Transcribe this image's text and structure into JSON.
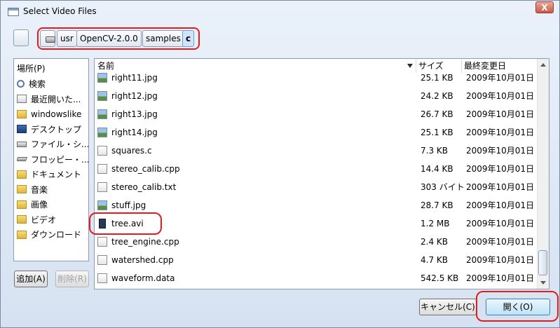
{
  "window": {
    "title": "Select Video Files",
    "close_glyph": "X"
  },
  "path": {
    "segments": [
      "usr",
      "OpenCV-2.0.0",
      "samples",
      "c"
    ]
  },
  "places": {
    "header": "場所(P)",
    "items": [
      {
        "label": "検索",
        "icon": "search-icon"
      },
      {
        "label": "最近開いた...",
        "icon": "recent-icon"
      },
      {
        "label": "windowslike",
        "icon": "folder-icon"
      },
      {
        "label": "デスクトップ",
        "icon": "desktop-icon"
      },
      {
        "label": "ファイル・シ...",
        "icon": "drive-icon"
      },
      {
        "label": "フロッピー・...",
        "icon": "floppy-icon"
      },
      {
        "label": "ドキュメント",
        "icon": "folder-icon"
      },
      {
        "label": "音楽",
        "icon": "folder-icon"
      },
      {
        "label": "画像",
        "icon": "folder-icon"
      },
      {
        "label": "ビデオ",
        "icon": "folder-icon"
      },
      {
        "label": "ダウンロード",
        "icon": "download-folder-icon"
      }
    ],
    "add_label": "追加(A)",
    "remove_label": "削除(R)"
  },
  "filelist": {
    "columns": {
      "name": "名前",
      "size": "サイズ",
      "modified": "最終変更日"
    },
    "rows": [
      {
        "name": "right11.jpg",
        "size": "25.1 KB",
        "date": "2009年10月01日",
        "type": "image"
      },
      {
        "name": "right12.jpg",
        "size": "24.2 KB",
        "date": "2009年10月01日",
        "type": "image"
      },
      {
        "name": "right13.jpg",
        "size": "26.7 KB",
        "date": "2009年10月01日",
        "type": "image"
      },
      {
        "name": "right14.jpg",
        "size": "25.1 KB",
        "date": "2009年10月01日",
        "type": "image"
      },
      {
        "name": "squares.c",
        "size": "7.3 KB",
        "date": "2009年10月01日",
        "type": "text"
      },
      {
        "name": "stereo_calib.cpp",
        "size": "14.4 KB",
        "date": "2009年10月01日",
        "type": "text"
      },
      {
        "name": "stereo_calib.txt",
        "size": "303 バイト",
        "date": "2009年10月01日",
        "type": "text"
      },
      {
        "name": "stuff.jpg",
        "size": "28.7 KB",
        "date": "2009年10月01日",
        "type": "image"
      },
      {
        "name": "tree.avi",
        "size": "1.2 MB",
        "date": "2009年10月01日",
        "type": "video"
      },
      {
        "name": "tree_engine.cpp",
        "size": "2.4 KB",
        "date": "2009年10月01日",
        "type": "text"
      },
      {
        "name": "watershed.cpp",
        "size": "4.7 KB",
        "date": "2009年10月01日",
        "type": "text"
      },
      {
        "name": "waveform.data",
        "size": "542.5 KB",
        "date": "2009年10月01日",
        "type": "text"
      }
    ]
  },
  "buttons": {
    "cancel": "キャンセル(C)",
    "open": "開く(O)"
  }
}
